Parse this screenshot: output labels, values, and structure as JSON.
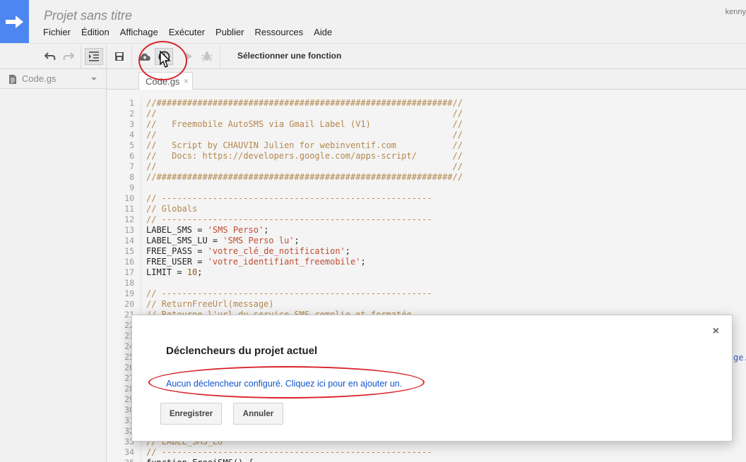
{
  "header": {
    "project_title": "Projet sans titre",
    "user": "kenny",
    "menu": [
      "Fichier",
      "Édition",
      "Affichage",
      "Exécuter",
      "Publier",
      "Ressources",
      "Aide"
    ]
  },
  "toolbar": {
    "function_select": "Sélectionner une fonction",
    "icons": [
      "undo-icon",
      "redo-icon",
      "indent-icon",
      "save-icon",
      "cloud-upload-icon",
      "clock-trigger-icon",
      "run-icon",
      "debug-bug-icon"
    ]
  },
  "sidebar": {
    "file_label": "Code.gs"
  },
  "tab": {
    "label": "Code.gs",
    "close": "×"
  },
  "editor": {
    "lines": [
      {
        "n": "1",
        "text": "//##########################################################//",
        "kind": "c"
      },
      {
        "n": "2",
        "text": "//                                                          //",
        "kind": "c"
      },
      {
        "n": "3",
        "text": "//   Freemobile AutoSMS via Gmail Label (V1)                //",
        "kind": "c"
      },
      {
        "n": "4",
        "text": "//                                                          //",
        "kind": "c"
      },
      {
        "n": "5",
        "text": "//   Script by CHAUVIN Julien for webinventif.com           //",
        "kind": "c"
      },
      {
        "n": "6",
        "text": "//   Docs: https://developers.google.com/apps-script/       //",
        "kind": "c"
      },
      {
        "n": "7",
        "text": "//                                                          //",
        "kind": "c"
      },
      {
        "n": "8",
        "text": "//##########################################################//",
        "kind": "c"
      },
      {
        "n": "9",
        "text": "",
        "kind": "c"
      },
      {
        "n": "10",
        "text": "// -----------------------------------------------------",
        "kind": "c"
      },
      {
        "n": "11",
        "text": "// Globals",
        "kind": "c"
      },
      {
        "n": "12",
        "text": "// -----------------------------------------------------",
        "kind": "c"
      },
      {
        "n": "13",
        "text": "",
        "kind": "code",
        "pre": "LABEL_SMS = ",
        "str": "'SMS Perso'",
        "post": ";"
      },
      {
        "n": "14",
        "text": "",
        "kind": "code",
        "pre": "LABEL_SMS_LU = ",
        "str": "'SMS Perso lu'",
        "post": ";"
      },
      {
        "n": "15",
        "text": "",
        "kind": "code",
        "pre": "FREE_PASS = ",
        "str": "'votre_clé_de_notification'",
        "post": ";"
      },
      {
        "n": "16",
        "text": "",
        "kind": "code",
        "pre": "FREE_USER = ",
        "str": "'votre_identifiant_freemobile'",
        "post": ";"
      },
      {
        "n": "17",
        "text": "",
        "kind": "num",
        "pre": "LIMIT = ",
        "str": "10",
        "post": ";"
      },
      {
        "n": "18",
        "text": "",
        "kind": "c"
      },
      {
        "n": "19",
        "text": "// -----------------------------------------------------",
        "kind": "c"
      },
      {
        "n": "20",
        "text": "// ReturnFreeUrl(message)",
        "kind": "c"
      },
      {
        "n": "21",
        "text": "// Retourne l'url du service SMS remplie et formatée",
        "kind": "c"
      },
      {
        "n": "22",
        "text": "",
        "kind": "c"
      },
      {
        "n": "23",
        "text": "",
        "kind": "c"
      },
      {
        "n": "24",
        "text": "",
        "kind": "c"
      },
      {
        "n": "25",
        "text": "",
        "kind": "c"
      },
      {
        "n": "26",
        "text": "",
        "kind": "c"
      },
      {
        "n": "27",
        "text": "",
        "kind": "c"
      },
      {
        "n": "28",
        "text": "",
        "kind": "c"
      },
      {
        "n": "29",
        "text": "",
        "kind": "c"
      },
      {
        "n": "30",
        "text": "",
        "kind": "c"
      },
      {
        "n": "31",
        "text": "",
        "kind": "c"
      },
      {
        "n": "32",
        "text": "",
        "kind": "c"
      },
      {
        "n": "33",
        "text": "// LABEL_SMS_LU",
        "kind": "c"
      },
      {
        "n": "34",
        "text": "// -----------------------------------------------------",
        "kind": "c"
      },
      {
        "n": "35",
        "text": "function FreeiSMS() {",
        "kind": "k"
      }
    ],
    "right_fragment": "ge.s"
  },
  "dialog": {
    "close": "×",
    "title": "Déclencheurs du projet actuel",
    "link": "Aucun déclencheur configuré. Cliquez ici pour en ajouter un.",
    "save_button": "Enregistrer",
    "cancel_button": "Annuler"
  },
  "colors": {
    "logo_blue": "#4d86f0",
    "annotation_red": "#d8232a",
    "link_blue": "#1155cc",
    "comment": "#b4884d",
    "string": "#c04c33"
  }
}
